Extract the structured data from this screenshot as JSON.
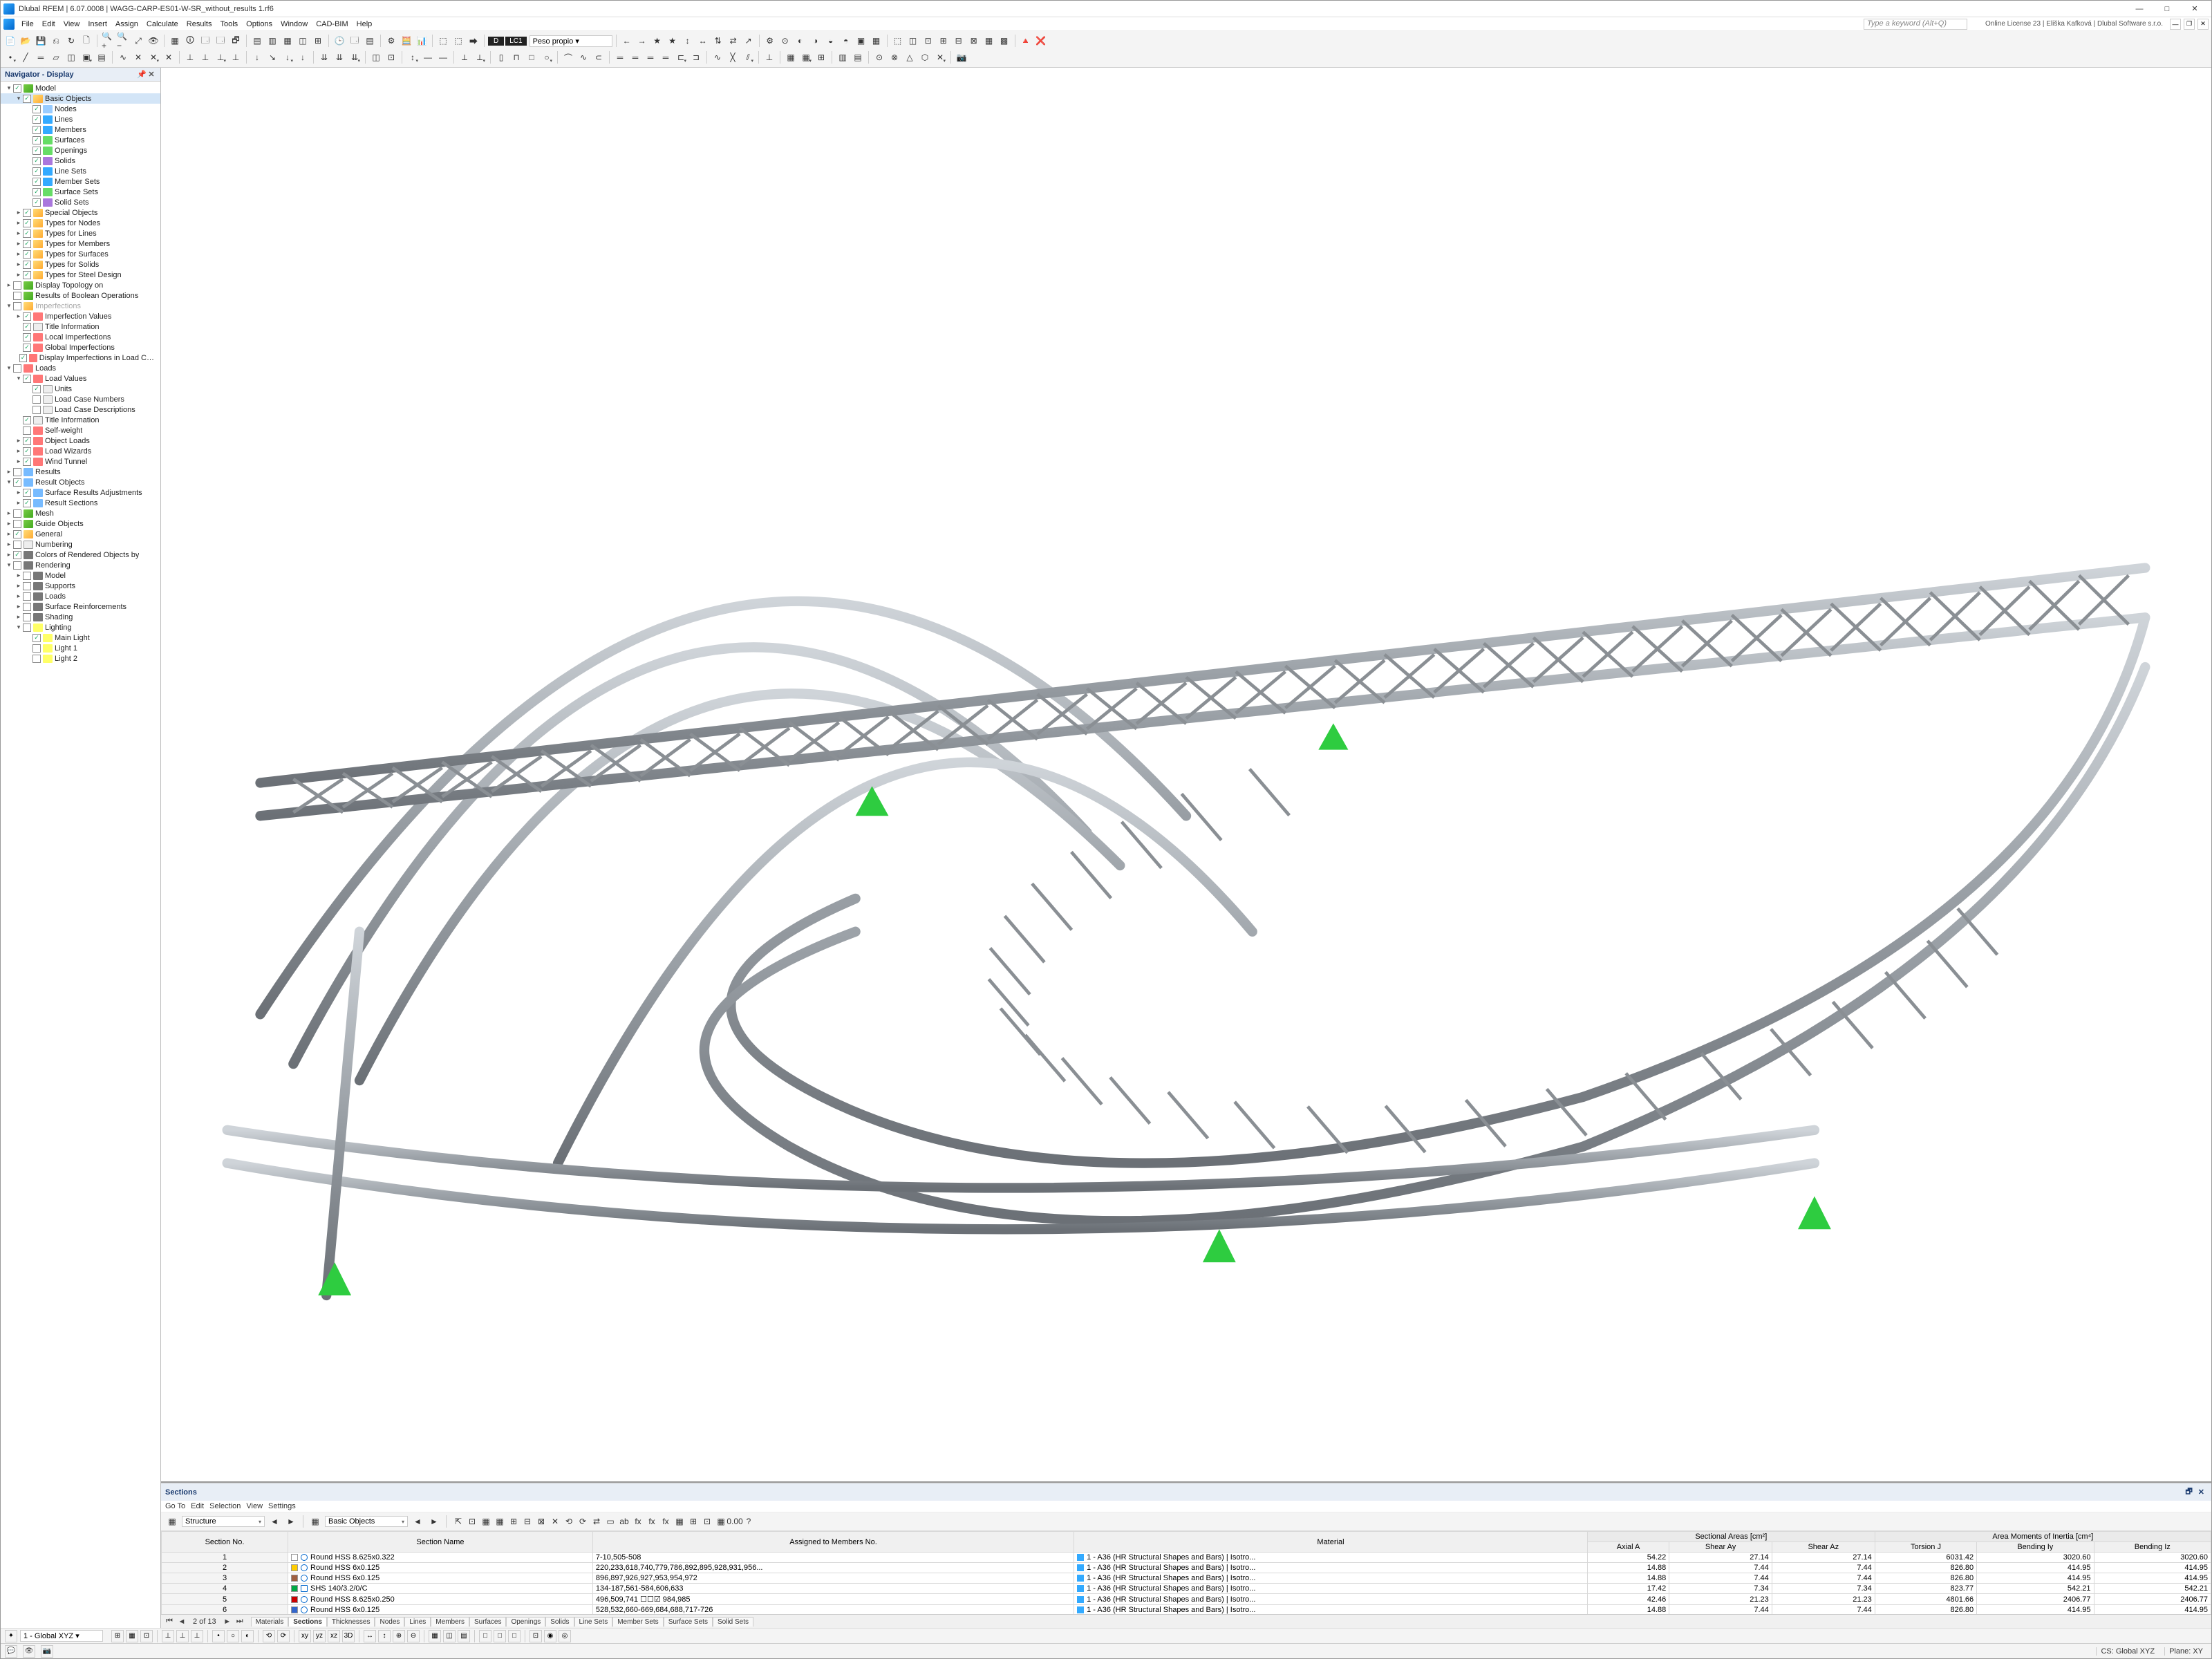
{
  "window": {
    "title": "Dlubal RFEM | 6.07.0008 | WAGG-CARP-ES01-W-SR_without_results 1.rf6",
    "license": "Online License 23 | Eliška Kafková | Dlubal Software s.r.o.",
    "keyword_placeholder": "Type a keyword (Alt+Q)"
  },
  "menu": [
    "File",
    "Edit",
    "View",
    "Insert",
    "Assign",
    "Calculate",
    "Results",
    "Tools",
    "Options",
    "Window",
    "CAD-BIM",
    "Help"
  ],
  "loadcase": {
    "tag": "LC1",
    "name": "Peso propio"
  },
  "navigator": {
    "title": "Navigator - Display",
    "items": [
      {
        "d": 0,
        "tw": "−",
        "chk": true,
        "ic": "ic-model",
        "label": "Model"
      },
      {
        "d": 1,
        "tw": "−",
        "chk": true,
        "ic": "ic-folder",
        "label": "Basic Objects",
        "sel": true
      },
      {
        "d": 2,
        "tw": "",
        "chk": true,
        "ic": "ic-node",
        "label": "Nodes"
      },
      {
        "d": 2,
        "tw": "",
        "chk": true,
        "ic": "ic-line",
        "label": "Lines"
      },
      {
        "d": 2,
        "tw": "",
        "chk": true,
        "ic": "ic-line",
        "label": "Members"
      },
      {
        "d": 2,
        "tw": "",
        "chk": true,
        "ic": "ic-surf",
        "label": "Surfaces"
      },
      {
        "d": 2,
        "tw": "",
        "chk": true,
        "ic": "ic-surf",
        "label": "Openings"
      },
      {
        "d": 2,
        "tw": "",
        "chk": true,
        "ic": "ic-solid",
        "label": "Solids"
      },
      {
        "d": 2,
        "tw": "",
        "chk": true,
        "ic": "ic-line",
        "label": "Line Sets"
      },
      {
        "d": 2,
        "tw": "",
        "chk": true,
        "ic": "ic-line",
        "label": "Member Sets"
      },
      {
        "d": 2,
        "tw": "",
        "chk": true,
        "ic": "ic-surf",
        "label": "Surface Sets"
      },
      {
        "d": 2,
        "tw": "",
        "chk": true,
        "ic": "ic-solid",
        "label": "Solid Sets"
      },
      {
        "d": 1,
        "tw": "+",
        "chk": true,
        "ic": "ic-folder",
        "label": "Special Objects"
      },
      {
        "d": 1,
        "tw": "+",
        "chk": true,
        "ic": "ic-folder",
        "label": "Types for Nodes"
      },
      {
        "d": 1,
        "tw": "+",
        "chk": true,
        "ic": "ic-folder",
        "label": "Types for Lines"
      },
      {
        "d": 1,
        "tw": "+",
        "chk": true,
        "ic": "ic-folder",
        "label": "Types for Members"
      },
      {
        "d": 1,
        "tw": "+",
        "chk": true,
        "ic": "ic-folder",
        "label": "Types for Surfaces"
      },
      {
        "d": 1,
        "tw": "+",
        "chk": true,
        "ic": "ic-folder",
        "label": "Types for Solids"
      },
      {
        "d": 1,
        "tw": "+",
        "chk": true,
        "ic": "ic-folder",
        "label": "Types for Steel Design"
      },
      {
        "d": 0,
        "tw": "+",
        "chk": false,
        "ic": "ic-model",
        "label": "Display Topology on"
      },
      {
        "d": 0,
        "tw": "",
        "chk": false,
        "ic": "ic-model",
        "label": "Results of Boolean Operations"
      },
      {
        "d": 0,
        "tw": "−",
        "chk": false,
        "ic": "ic-folder",
        "label": "Imperfections",
        "dim": true
      },
      {
        "d": 1,
        "tw": "+",
        "chk": true,
        "ic": "ic-load",
        "label": "Imperfection Values"
      },
      {
        "d": 1,
        "tw": "",
        "chk": true,
        "ic": "ic-num",
        "label": "Title Information"
      },
      {
        "d": 1,
        "tw": "",
        "chk": true,
        "ic": "ic-load",
        "label": "Local Imperfections"
      },
      {
        "d": 1,
        "tw": "",
        "chk": true,
        "ic": "ic-load",
        "label": "Global Imperfections"
      },
      {
        "d": 1,
        "tw": "",
        "chk": true,
        "ic": "ic-load",
        "label": "Display Imperfections in Load Cases & ..."
      },
      {
        "d": 0,
        "tw": "−",
        "chk": false,
        "ic": "ic-load",
        "label": "Loads"
      },
      {
        "d": 1,
        "tw": "−",
        "chk": true,
        "ic": "ic-load",
        "label": "Load Values"
      },
      {
        "d": 2,
        "tw": "",
        "chk": true,
        "ic": "ic-num",
        "label": "Units"
      },
      {
        "d": 2,
        "tw": "",
        "chk": false,
        "ic": "ic-num",
        "label": "Load Case Numbers"
      },
      {
        "d": 2,
        "tw": "",
        "chk": false,
        "ic": "ic-num",
        "label": "Load Case Descriptions"
      },
      {
        "d": 1,
        "tw": "",
        "chk": true,
        "ic": "ic-num",
        "label": "Title Information"
      },
      {
        "d": 1,
        "tw": "",
        "chk": false,
        "ic": "ic-load",
        "label": "Self-weight"
      },
      {
        "d": 1,
        "tw": "+",
        "chk": true,
        "ic": "ic-load",
        "label": "Object Loads"
      },
      {
        "d": 1,
        "tw": "+",
        "chk": true,
        "ic": "ic-load",
        "label": "Load Wizards"
      },
      {
        "d": 1,
        "tw": "+",
        "chk": true,
        "ic": "ic-load",
        "label": "Wind Tunnel"
      },
      {
        "d": 0,
        "tw": "+",
        "chk": false,
        "ic": "ic-res",
        "label": "Results"
      },
      {
        "d": 0,
        "tw": "−",
        "chk": true,
        "ic": "ic-res",
        "label": "Result Objects"
      },
      {
        "d": 1,
        "tw": "+",
        "chk": true,
        "ic": "ic-res",
        "label": "Surface Results Adjustments"
      },
      {
        "d": 1,
        "tw": "+",
        "chk": true,
        "ic": "ic-res",
        "label": "Result Sections"
      },
      {
        "d": 0,
        "tw": "+",
        "chk": false,
        "ic": "ic-model",
        "label": "Mesh"
      },
      {
        "d": 0,
        "tw": "+",
        "chk": false,
        "ic": "ic-model",
        "label": "Guide Objects"
      },
      {
        "d": 0,
        "tw": "+",
        "chk": true,
        "ic": "ic-folder",
        "label": "General"
      },
      {
        "d": 0,
        "tw": "+",
        "chk": false,
        "ic": "ic-num",
        "label": "Numbering"
      },
      {
        "d": 0,
        "tw": "+",
        "chk": true,
        "ic": "ic-render",
        "label": "Colors of Rendered Objects by"
      },
      {
        "d": 0,
        "tw": "−",
        "chk": false,
        "ic": "ic-render",
        "label": "Rendering"
      },
      {
        "d": 1,
        "tw": "+",
        "chk": false,
        "ic": "ic-render",
        "label": "Model"
      },
      {
        "d": 1,
        "tw": "+",
        "chk": false,
        "ic": "ic-render",
        "label": "Supports"
      },
      {
        "d": 1,
        "tw": "+",
        "chk": false,
        "ic": "ic-render",
        "label": "Loads"
      },
      {
        "d": 1,
        "tw": "+",
        "chk": false,
        "ic": "ic-render",
        "label": "Surface Reinforcements"
      },
      {
        "d": 1,
        "tw": "+",
        "chk": false,
        "ic": "ic-render",
        "label": "Shading"
      },
      {
        "d": 1,
        "tw": "−",
        "chk": false,
        "ic": "ic-light",
        "label": "Lighting"
      },
      {
        "d": 2,
        "tw": "",
        "chk": true,
        "ic": "ic-light",
        "label": "Main Light"
      },
      {
        "d": 2,
        "tw": "",
        "chk": false,
        "ic": "ic-light",
        "label": "Light 1"
      },
      {
        "d": 2,
        "tw": "",
        "chk": false,
        "ic": "ic-light",
        "label": "Light 2"
      }
    ]
  },
  "sections": {
    "title": "Sections",
    "menu": [
      "Go To",
      "Edit",
      "Selection",
      "View",
      "Settings"
    ],
    "combo1": "Structure",
    "combo2": "Basic Objects",
    "group1": "Sectional Areas [cm²]",
    "group2": "Area Moments of Inertia [cm⁴]",
    "headers": [
      "Section No.",
      "Section Name",
      "Assigned to Members No.",
      "Material",
      "Axial A",
      "Shear Ay",
      "Shear Az",
      "Torsion J",
      "Bending Iy",
      "Bending Iz"
    ],
    "rows": [
      {
        "no": "1",
        "sw": "#ffffff",
        "name": "Round HSS 8.625x0.322",
        "assigned": "7-10,505-508",
        "mat": "1 - A36 (HR Structural Shapes and Bars) | Isotro...",
        "A": "54.22",
        "Ay": "27.14",
        "Az": "27.14",
        "J": "6031.42",
        "Iy": "3020.60",
        "Iz": "3020.60"
      },
      {
        "no": "2",
        "sw": "#ffcc00",
        "name": "Round HSS 6x0.125",
        "assigned": "220,233,618,740,779,786,892,895,928,931,956...",
        "mat": "1 - A36 (HR Structural Shapes and Bars) | Isotro...",
        "A": "14.88",
        "Ay": "7.44",
        "Az": "7.44",
        "J": "826.80",
        "Iy": "414.95",
        "Iz": "414.95"
      },
      {
        "no": "3",
        "sw": "#a06040",
        "name": "Round HSS 6x0.125",
        "assigned": "896,897,926,927,953,954,972",
        "mat": "1 - A36 (HR Structural Shapes and Bars) | Isotro...",
        "A": "14.88",
        "Ay": "7.44",
        "Az": "7.44",
        "J": "826.80",
        "Iy": "414.95",
        "Iz": "414.95"
      },
      {
        "no": "4",
        "sw": "#00aa44",
        "name": "SHS 140/3.2/0/C",
        "assigned": "134-187,561-584,606,633",
        "mat": "1 - A36 (HR Structural Shapes and Bars) | Isotro...",
        "A": "17.42",
        "Ay": "7.34",
        "Az": "7.34",
        "J": "823.77",
        "Iy": "542.21",
        "Iz": "542.21"
      },
      {
        "no": "5",
        "sw": "#cc0000",
        "name": "Round HSS 8.625x0.250",
        "assigned": "496,509,741 ☐☐☑ 984,985",
        "mat": "1 - A36 (HR Structural Shapes and Bars) | Isotro...",
        "A": "42.46",
        "Ay": "21.23",
        "Az": "21.23",
        "J": "4801.66",
        "Iy": "2406.77",
        "Iz": "2406.77"
      },
      {
        "no": "6",
        "sw": "#3366cc",
        "name": "Round HSS 6x0.125",
        "assigned": "528,532,660-669,684,688,717-726",
        "mat": "1 - A36 (HR Structural Shapes and Bars) | Isotro...",
        "A": "14.88",
        "Ay": "7.44",
        "Az": "7.44",
        "J": "826.80",
        "Iy": "414.95",
        "Iz": "414.95"
      }
    ],
    "pager": "2 of 13",
    "tabs": [
      "Materials",
      "Sections",
      "Thicknesses",
      "Nodes",
      "Lines",
      "Members",
      "Surfaces",
      "Openings",
      "Solids",
      "Line Sets",
      "Member Sets",
      "Surface Sets",
      "Solid Sets"
    ],
    "active_tab": "Sections"
  },
  "status": {
    "cs": "1 - Global XYZ",
    "cs_label": "CS: Global XYZ",
    "plane": "Plane: XY"
  }
}
